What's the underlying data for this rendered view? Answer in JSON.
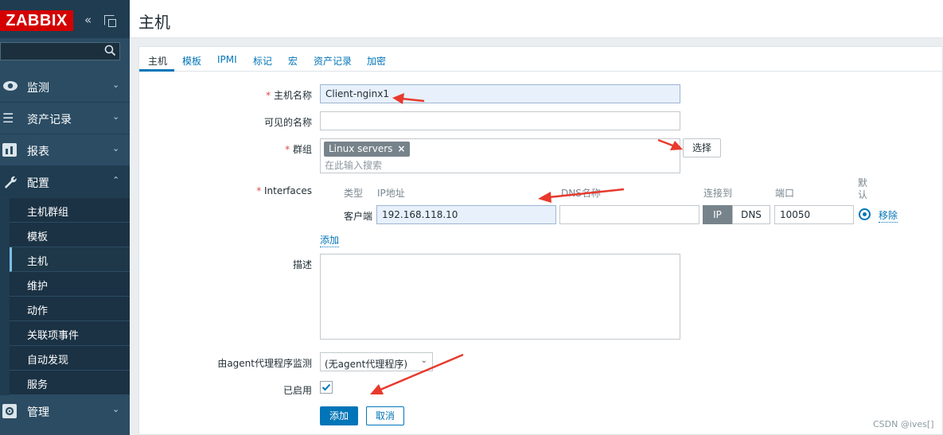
{
  "brand": {
    "logo_text": "ZABBIX",
    "accent": "#d40000",
    "sidebar_bg": "#2b4c63"
  },
  "sidebar": {
    "collapse_icon": "chevron-double-left-icon",
    "kiosk_icon": "kiosk-mode-icon",
    "search_placeholder": "",
    "menus": [
      {
        "label": "监测",
        "icon": "eye-icon"
      },
      {
        "label": "资产记录",
        "icon": "list-icon"
      },
      {
        "label": "报表",
        "icon": "bar-chart-icon"
      },
      {
        "label": "配置",
        "icon": "wrench-icon"
      },
      {
        "label": "管理",
        "icon": "gear-icon"
      }
    ],
    "config_submenu": [
      "主机群组",
      "模板",
      "主机",
      "维护",
      "动作",
      "关联项事件",
      "自动发现",
      "服务"
    ],
    "active_sub": "主机"
  },
  "header": {
    "title": "主机"
  },
  "tabs": [
    "主机",
    "模板",
    "IPMI",
    "标记",
    "宏",
    "资产记录",
    "加密"
  ],
  "form": {
    "req_mark": "*",
    "hostname": {
      "label": "主机名称",
      "value": "Client-nginx1"
    },
    "visible_name": {
      "label": "可见的名称",
      "value": ""
    },
    "groups": {
      "label": "群组",
      "chip": "Linux servers",
      "chip_remove": "×",
      "placeholder": "在此输入搜索",
      "select_button": "选择"
    },
    "interfaces": {
      "label": "Interfaces",
      "headers": {
        "type": "类型",
        "ip": "IP地址",
        "dns": "DNS名称",
        "connect": "连接到",
        "port": "端口",
        "default": "默认"
      },
      "row": {
        "type": "客户端",
        "ip": "192.168.118.10",
        "dns": "",
        "connect_ip": "IP",
        "connect_dns": "DNS",
        "port": "10050",
        "remove": "移除"
      },
      "add_link": "添加"
    },
    "description": {
      "label": "描述",
      "value": ""
    },
    "proxy": {
      "label": "由agent代理程序监测",
      "value": "(无agent代理程序)"
    },
    "enabled": {
      "label": "已启用",
      "checked": true
    },
    "buttons": {
      "add": "添加",
      "cancel": "取消"
    }
  },
  "watermark": "CSDN @ives[]"
}
